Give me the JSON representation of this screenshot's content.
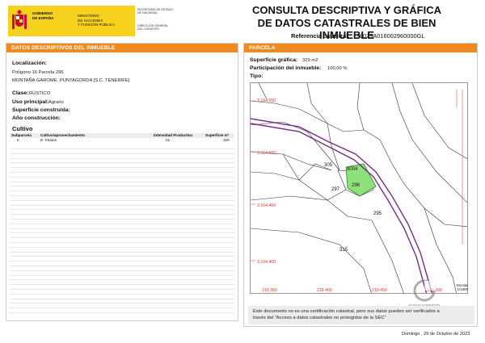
{
  "header": {
    "gobierno": "GOBIERNO",
    "de_espana": "DE ESPAÑA",
    "ministerio": [
      "MINISTERIO",
      "DE HACIENDA",
      "Y FUNCIÓN PÚBLICA"
    ],
    "secretaria": [
      "SECRETARÍA DE ESTADO",
      "DE HACIENDA"
    ],
    "direccion": [
      "DIRECCIÓN GENERAL",
      "DEL CATASTRO"
    ],
    "title_line1": "CONSULTA DESCRIPTIVA Y GRÁFICA",
    "title_line2": "DE DATOS CATASTRALES DE BIEN INMUEBLE",
    "ref_label": "Referencia catastral:",
    "ref_value": "38029A016002960000GL"
  },
  "left": {
    "header": "DATOS DESCRIPTIVOS DEL INMUEBLE",
    "localizacion_label": "Localización:",
    "localizacion_line1": "Polígono 16 Parcela 296",
    "localizacion_line2": "MONTAÑA GAROME. PUNTAGORDA [S.C. TENERIFE]",
    "clase_label": "Clase:",
    "clase_value": "RÚSTICO",
    "uso_label": "Uso principal:",
    "uso_value": "Agrario",
    "sup_const_label": "Superficie construida:",
    "anio_label": "Año construcción:",
    "cultivo_title": "Cultivo",
    "cultivo_headers": [
      "Subparcela",
      "Cultivo/aprovechamiento",
      "Intensidad Productiva",
      "Superficie m²"
    ],
    "cultivo_row": [
      "0",
      "E- Pastos",
      "01",
      "329"
    ]
  },
  "right": {
    "header": "PARCELA",
    "sup_grafica_label": "Superficie gráfica:",
    "sup_grafica_value": "329 m2",
    "participacion_label": "Participación del inmueble:",
    "participacion_value": "100,00 %",
    "tipo_label": "Tipo:",
    "parcela_section": "PARCELA",
    "map_labels": {
      "y1": "3.164.550",
      "y2": "3.164.500",
      "y3": "3.164.450",
      "y4": "3.164.400",
      "x1": "219.350",
      "x2": "219.400",
      "x3": "219.450",
      "x4": "219.500",
      "p305": "305",
      "p9004": "9004",
      "p297": "297",
      "p296": "296",
      "p295": "295",
      "p315": "315"
    },
    "scale_label": "Escala:",
    "scale_value": "1/1500",
    "watermark": "cocampo"
  },
  "notice_line1": "Este documento no es una certificación catastral, pero sus datos pueden ser verificados a",
  "notice_line2": "través del \"Acceso a datos catastrales no protegidos de la SEC\"",
  "date": "Domingo , 29 de Octubre de 2023",
  "colors": {
    "orange": "#f08a1c",
    "yellow": "#f6d21e",
    "parcel": "#8ee07a",
    "boundary": "#7a2a8a",
    "gridlabel": "#d9342b"
  }
}
